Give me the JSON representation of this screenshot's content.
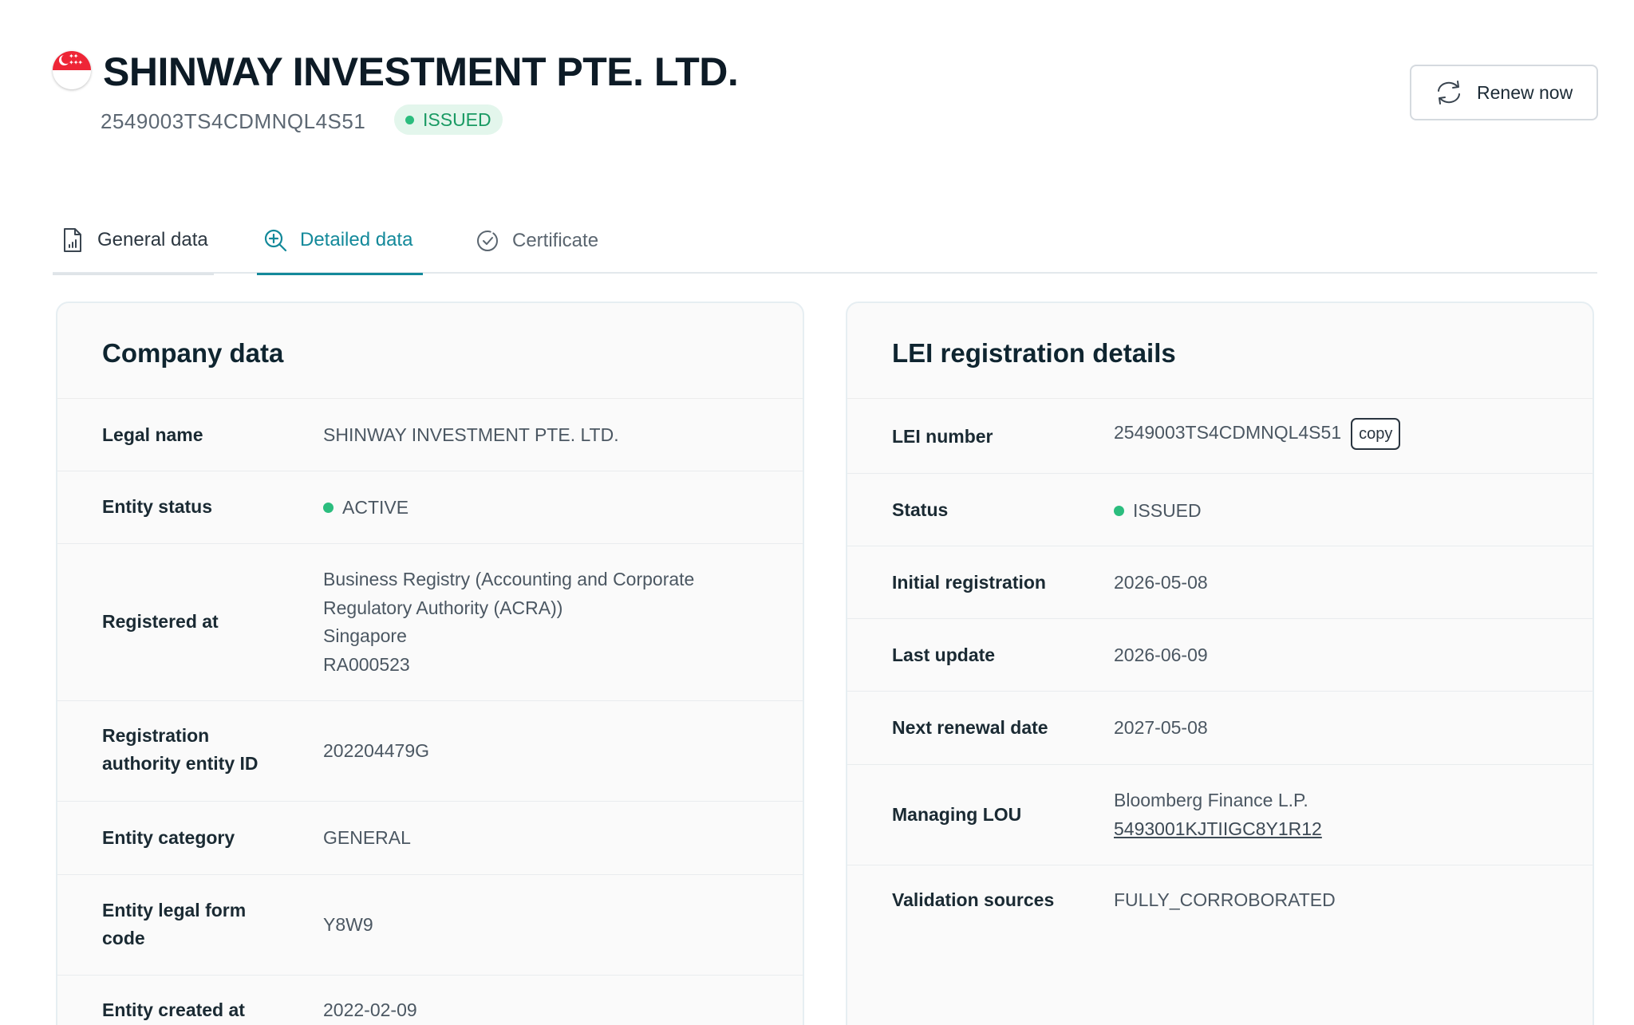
{
  "header": {
    "title": "SHINWAY INVESTMENT PTE. LTD.",
    "lei": "2549003TS4CDMNQL4S51",
    "status_badge": "ISSUED",
    "renew_label": "Renew now"
  },
  "tabs": [
    {
      "label": "General data",
      "icon": "document-chart-icon"
    },
    {
      "label": "Detailed data",
      "icon": "zoom-in-icon",
      "active": true
    },
    {
      "label": "Certificate",
      "icon": "check-circle-icon"
    }
  ],
  "company_data": {
    "title": "Company data",
    "legal_name": {
      "label": "Legal name",
      "value": "SHINWAY INVESTMENT PTE. LTD."
    },
    "entity_status": {
      "label": "Entity status",
      "value": "ACTIVE"
    },
    "registered_at": {
      "label": "Registered at",
      "lines": [
        "Business Registry (Accounting and Corporate",
        "Regulatory Authority (ACRA))",
        "Singapore",
        "RA000523"
      ]
    },
    "registration_authority_id": {
      "label_lines": [
        "Registration",
        "authority entity ID"
      ],
      "value": "202204479G"
    },
    "entity_category": {
      "label": "Entity category",
      "value": "GENERAL"
    },
    "legal_form_code": {
      "label_lines": [
        "Entity legal form",
        "code"
      ],
      "value": "Y8W9"
    },
    "entity_created_at": {
      "label": "Entity created at",
      "value": "2022-02-09"
    }
  },
  "lei_details": {
    "title": "LEI registration details",
    "lei_number": {
      "label": "LEI number",
      "value": "2549003TS4CDMNQL4S51",
      "copy_label": "copy"
    },
    "status": {
      "label": "Status",
      "value": "ISSUED"
    },
    "initial_registration": {
      "label": "Initial registration",
      "value": "2026-05-08"
    },
    "last_update": {
      "label": "Last update",
      "value": "2026-06-09"
    },
    "next_renewal": {
      "label": "Next renewal date",
      "value": "2027-05-08"
    },
    "managing_lou": {
      "label": "Managing LOU",
      "name": "Bloomberg Finance L.P.",
      "link": "5493001KJTIIGC8Y1R12"
    },
    "validation_sources": {
      "label": "Validation sources",
      "value": "FULLY_CORROBORATED"
    }
  },
  "colors": {
    "accent": "#13899a",
    "status_green": "#2bbd7e",
    "badge_bg": "#e3f6ec",
    "title_text": "#0d1b26"
  }
}
